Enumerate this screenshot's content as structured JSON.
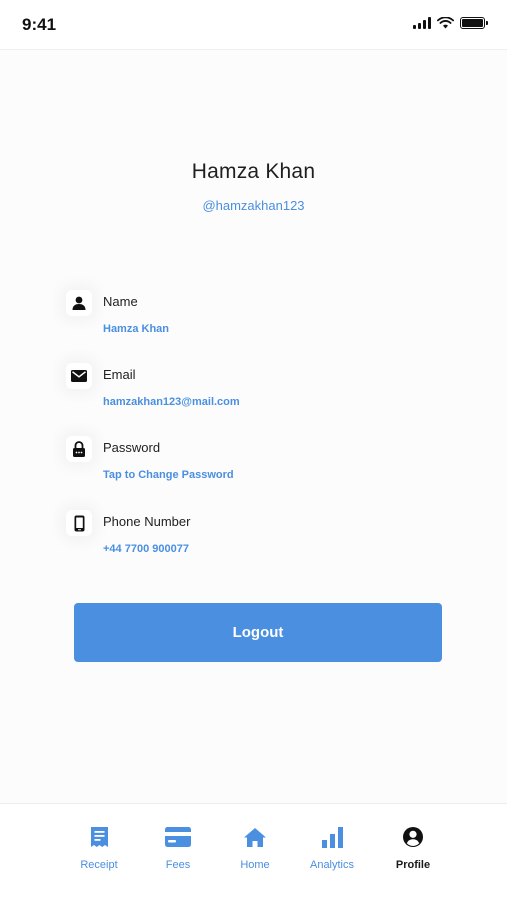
{
  "status_bar": {
    "time": "9:41"
  },
  "profile": {
    "name": "Hamza Khan",
    "handle": "@hamzakhan123"
  },
  "fields": [
    {
      "label": "Name",
      "value": "Hamza Khan",
      "icon": "user-icon"
    },
    {
      "label": "Email",
      "value": "hamzakhan123@mail.com",
      "icon": "mail-icon"
    },
    {
      "label": "Password",
      "value": "Tap to Change Password",
      "icon": "lock-icon"
    },
    {
      "label": "Phone Number",
      "value": "+44 7700 900077",
      "icon": "phone-icon"
    }
  ],
  "logout_label": "Logout",
  "tabs": [
    {
      "label": "Receipt",
      "icon": "receipt-icon"
    },
    {
      "label": "Fees",
      "icon": "card-icon"
    },
    {
      "label": "Home",
      "icon": "home-icon"
    },
    {
      "label": "Analytics",
      "icon": "bar-chart-icon"
    },
    {
      "label": "Profile",
      "icon": "profile-icon",
      "active": true
    }
  ],
  "colors": {
    "accent": "#4a8fe0",
    "text": "#1f1f1f",
    "background": "#fcfcfc"
  }
}
